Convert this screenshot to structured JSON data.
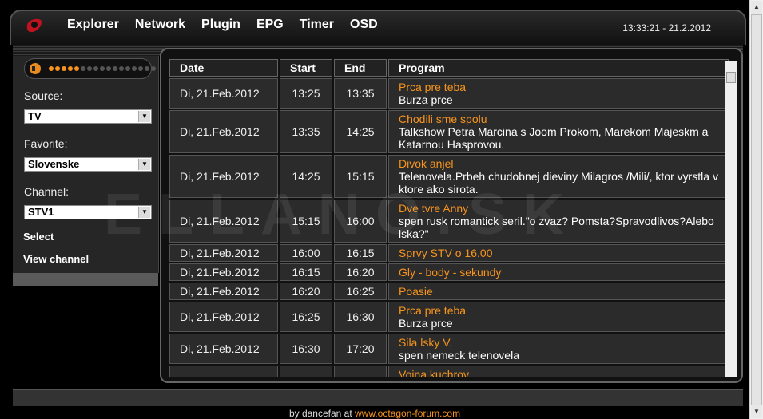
{
  "header": {
    "menu": [
      "Explorer",
      "Network",
      "Plugin",
      "EPG",
      "Timer",
      "OSD"
    ],
    "clock": "13:33:21 - 21.2.2012"
  },
  "sidebar": {
    "volume_level": 0.45,
    "source_label": "Source:",
    "source_value": "TV",
    "favorite_label": "Favorite:",
    "favorite_value": "Slovenske",
    "channel_label": "Channel:",
    "channel_value": "STV1",
    "select_link": "Select",
    "view_channel_link": "View channel"
  },
  "table": {
    "headers": [
      "Date",
      "Start",
      "End",
      "Program"
    ],
    "rows": [
      {
        "date": "Di, 21.Feb.2012",
        "start": "13:25",
        "end": "13:35",
        "title": "Prca pre teba",
        "desc": "Burza prce"
      },
      {
        "date": "Di, 21.Feb.2012",
        "start": "13:35",
        "end": "14:25",
        "title": "Chodili sme spolu",
        "desc": "Talkshow Petra Marcina s Joom Prokom, Marekom Majeskm a Katarnou Hasprovou."
      },
      {
        "date": "Di, 21.Feb.2012",
        "start": "14:25",
        "end": "15:15",
        "title": "Divok anjel",
        "desc": "Telenovela.Prbeh chudobnej dieviny Milagros /Mili/, ktor vyrstla v ktore ako sirota."
      },
      {
        "date": "Di, 21.Feb.2012",
        "start": "15:15",
        "end": "16:00",
        "title": "Dve tvre Anny",
        "desc": "spen rusk romantick seril.\"o zvaz? Pomsta?Spravodlivos?Alebo lska?\""
      },
      {
        "date": "Di, 21.Feb.2012",
        "start": "16:00",
        "end": "16:15",
        "title": "Sprvy STV o 16.00",
        "desc": ""
      },
      {
        "date": "Di, 21.Feb.2012",
        "start": "16:15",
        "end": "16:20",
        "title": "Gly - body - sekundy",
        "desc": ""
      },
      {
        "date": "Di, 21.Feb.2012",
        "start": "16:20",
        "end": "16:25",
        "title": "Poasie",
        "desc": ""
      },
      {
        "date": "Di, 21.Feb.2012",
        "start": "16:25",
        "end": "16:30",
        "title": "Prca pre teba",
        "desc": "Burza prce"
      },
      {
        "date": "Di, 21.Feb.2012",
        "start": "16:30",
        "end": "17:20",
        "title": "Sila lsky V.",
        "desc": "spen nemeck telenovela"
      },
      {
        "date": "",
        "start": "",
        "end": "",
        "title": "Vojna kuchrov",
        "desc": ""
      }
    ]
  },
  "watermark": "ELLANO.SK",
  "footer": {
    "prefix": "by dancefan at",
    "link": "www.octagon-forum.com"
  },
  "colors": {
    "accent": "#f7941d",
    "logo": "#c1121f"
  }
}
